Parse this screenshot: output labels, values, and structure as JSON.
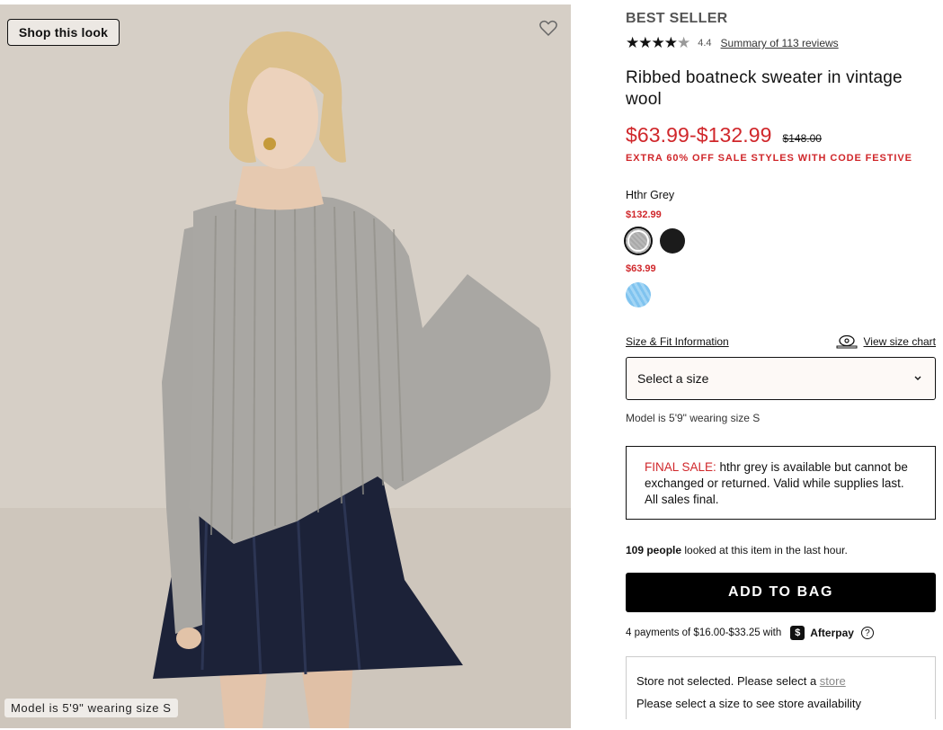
{
  "image": {
    "shop_look_label": "Shop this look",
    "model_caption": "Model is 5'9\" wearing size S"
  },
  "product": {
    "badge": "BEST SELLER",
    "rating": {
      "stars_filled": 4.4,
      "value": "4.4",
      "reviews_link": "Summary of 113 reviews"
    },
    "title": "Ribbed boatneck sweater in vintage wool",
    "sale_price": "$63.99-$132.99",
    "original_price": "$148.00",
    "promo": "EXTRA 60% OFF SALE STYLES WITH CODE FESTIVE"
  },
  "colors": {
    "selected_name": "Hthr Grey",
    "groups": [
      {
        "price": "$132.99",
        "swatches": [
          "hthr-grey",
          "black"
        ]
      },
      {
        "price": "$63.99",
        "swatches": [
          "light-blue"
        ]
      }
    ]
  },
  "sizing": {
    "info_link": "Size & Fit Information",
    "chart_link": "View size chart",
    "select_placeholder": "Select a size",
    "model_note": "Model is 5'9\" wearing size S"
  },
  "final_sale": {
    "label": "FINAL SALE:",
    "message": " hthr grey is available but cannot be exchanged or returned. Valid while supplies last. All sales final."
  },
  "viewers": {
    "count": "109 people",
    "text": " looked at this item in the last hour."
  },
  "cart": {
    "add_label": "ADD TO BAG"
  },
  "afterpay": {
    "text": "4 payments of $16.00-$33.25 with",
    "logo_glyph": "$",
    "brand": "Afterpay",
    "help_glyph": "?"
  },
  "store": {
    "line1_prefix": "Store not selected. Please select a ",
    "line1_link": "store",
    "line2": "Please select a size to see store availability"
  },
  "colors_palette": {
    "sale_red": "#d0272b",
    "button_black": "#000000"
  }
}
